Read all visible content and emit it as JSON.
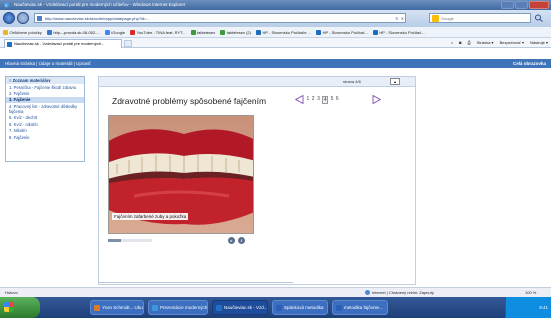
{
  "window": {
    "title": "Naučteviac.sk - Vzdelávací portál pre moderných učiteľov - Windows Internet Explorer",
    "url": "http://www.naucteviac.sk/sk/ucitel/app/data/page.php?id=...",
    "search_placeholder": "Google"
  },
  "favorites": [
    {
      "label": "Obľúbené položky",
      "icon": "star-icon",
      "color": "#e8b62b"
    },
    {
      "label": "http---pravda.sk-08-052-...",
      "icon": "page-icon",
      "color": "#3a78c9"
    },
    {
      "label": "iGoogle",
      "icon": "google-icon",
      "color": "#4285f4"
    },
    {
      "label": "YouTube - TINA feat. RYT...",
      "icon": "youtube-icon",
      "color": "#d42b2b"
    },
    {
      "label": "tabletesex",
      "icon": "folder-icon",
      "color": "#3b9b3b"
    },
    {
      "label": "tabletesex (2)",
      "icon": "folder-icon",
      "color": "#3b9b3b"
    },
    {
      "label": "HP - Slovensko Počítače ...",
      "icon": "hp-icon",
      "color": "#1b6bbf"
    },
    {
      "label": "HP - Slovensko Počítač...",
      "icon": "hp-icon",
      "color": "#1b6bbf"
    },
    {
      "label": "HP - Slovensko Počítač...",
      "icon": "hp-icon",
      "color": "#1b6bbf"
    }
  ],
  "tab": {
    "label": "Naučteviac.sk - Vzdelávací portál pre moderných..."
  },
  "command_bar": [
    "Stránka ▾",
    "Bezpečnosť ▾",
    "Nástroje ▾"
  ],
  "site_nav": {
    "links": "Hlavná stránka | Údaje o materiáli | Upraviť",
    "fullscreen": "Celá obrazovka"
  },
  "left_menu": {
    "header": "≡ Zoznam materiálov",
    "items": [
      {
        "label": "1. Pesnička - Fajčenie škodí zdraviu",
        "active": false
      },
      {
        "label": "2. Fajčenie",
        "active": false
      },
      {
        "label": "3. Fajčenie",
        "active": true
      },
      {
        "label": "4. Pracovný list - zdravotné dôsledky fajčenia",
        "active": false
      },
      {
        "label": "5. Kvíz - dechtt",
        "active": false
      },
      {
        "label": "6. Kvíz - nikotín",
        "active": false
      },
      {
        "label": "7. Nikotín",
        "active": false
      },
      {
        "label": "8. Fajčenie",
        "active": false
      }
    ]
  },
  "content": {
    "page_label": "strana 4/6",
    "title": "Zdravotné problémy spôsobené fajčením",
    "pages": [
      "1",
      "2",
      "3",
      "4",
      "5",
      "6"
    ],
    "current_page": "4",
    "caption": "Fajčením zafarbené zuby a pokožka",
    "media_progress": 0.3
  },
  "status": {
    "left": "Hotovo",
    "zone": "Internet | Chránený režim: Zapnutý",
    "zoom": "100 %"
  },
  "taskbar": {
    "items": [
      {
        "label": "Yvon Schmidt... Ubul",
        "color": "#d97b2a",
        "active": false
      },
      {
        "label": "Prezentácie moderných...",
        "color": "#3a9ad9",
        "active": false
      },
      {
        "label": "Naučteviac.sk - Vzd...",
        "color": "#1f6fc5",
        "active": true
      },
      {
        "label": "Spánková metodika",
        "color": "#2b5fb5",
        "active": false
      },
      {
        "label": "metodika fajčenie...",
        "color": "#2b5fb5",
        "active": false
      }
    ],
    "clock": "9:41"
  }
}
